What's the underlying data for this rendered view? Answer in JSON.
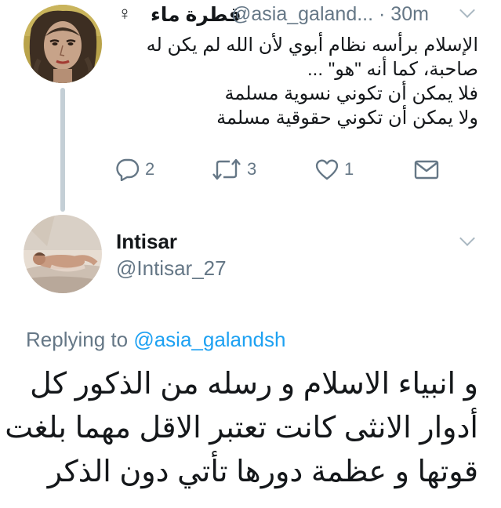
{
  "parent_tweet": {
    "display_name": "قطرة ماء",
    "gender_symbol": "♀",
    "handle": "@asia_galand...",
    "separator": "·",
    "timestamp": "30m",
    "text_lines": [
      "الإسلام برأسه نظام أبوي لأن الله لم يكن له",
      "صاحبة، كما أنه \"هو\" ...",
      "فلا يمكن أن تكوني نسوية مسلمة",
      "ولا يمكن أن تكوني حقوقية مسلمة"
    ],
    "actions": {
      "reply_count": "2",
      "retweet_count": "3",
      "like_count": "1"
    }
  },
  "reply_tweet": {
    "display_name": "Intisar",
    "handle": "@Intisar_27",
    "replying_prefix": "Replying to",
    "replying_to": "@asia_galandsh",
    "text_lines": [
      "و انبياء الاسلام و رسله من الذكور  كل",
      "أدوار الانثى كانت تعتبر الاقل مهما بلغت",
      "قوتها و عظمة دورها تأتي دون الذكر"
    ]
  },
  "colors": {
    "primary_text": "#14171a",
    "secondary_text": "#657786",
    "link": "#1da1f2",
    "thread_line": "#c4cfd6"
  },
  "icons": {
    "reply": "reply-bubble-icon",
    "retweet": "retweet-arrows-icon",
    "like": "heart-outline-icon",
    "dm": "envelope-icon",
    "menu": "chevron-down-icon"
  }
}
